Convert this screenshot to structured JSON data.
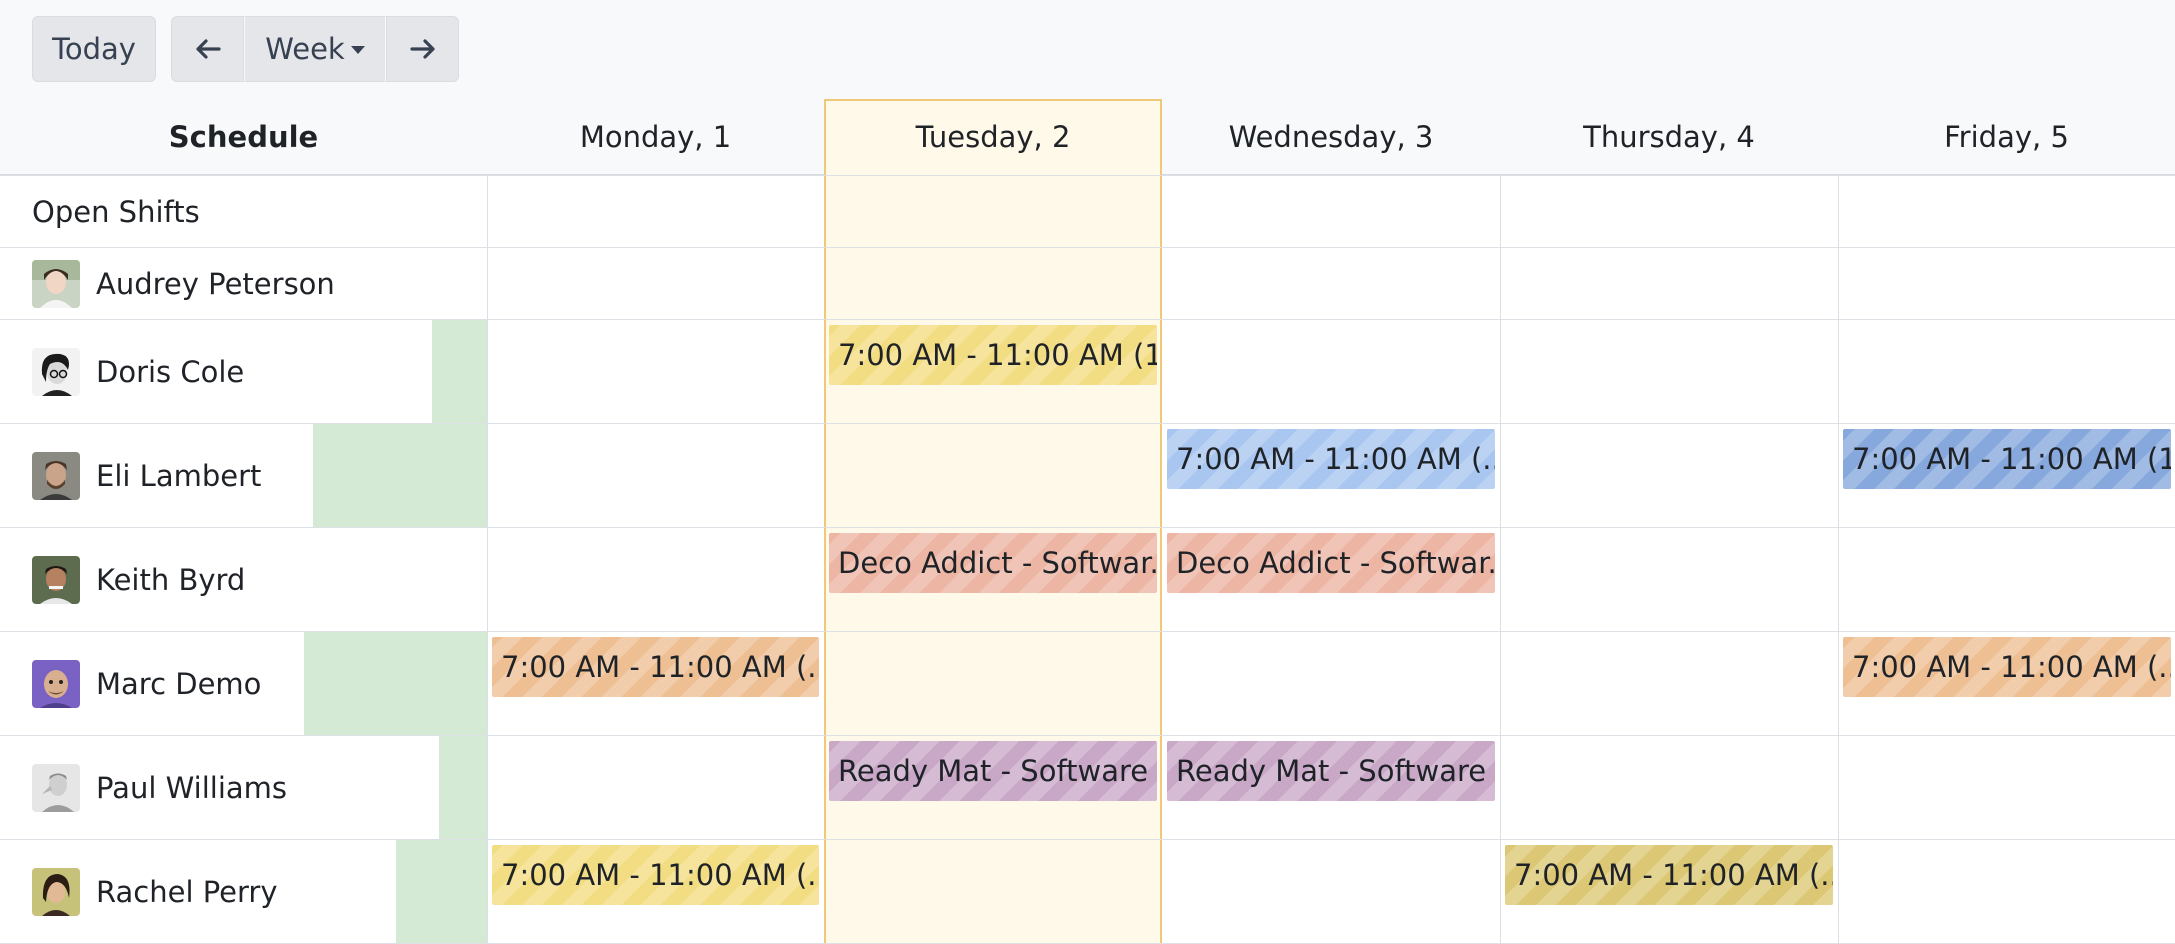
{
  "toolbar": {
    "today_label": "Today",
    "view_label": "Week",
    "prev_icon": "arrow-left-icon",
    "next_icon": "arrow-right-icon"
  },
  "header": {
    "schedule_label": "Schedule",
    "days": [
      "Monday, 1",
      "Tuesday, 2",
      "Wednesday, 3",
      "Thursday, 4",
      "Friday, 5"
    ],
    "today_index": 1
  },
  "rows": [
    {
      "name": "Open Shifts"
    },
    {
      "name": "Audrey Peterson"
    },
    {
      "name": "Doris Cole"
    },
    {
      "name": "Eli Lambert"
    },
    {
      "name": "Keith Byrd"
    },
    {
      "name": "Marc Demo"
    },
    {
      "name": "Paul Williams"
    },
    {
      "name": "Rachel Perry"
    }
  ],
  "shifts": {
    "doris_tue": "7:00 AM - 11:00 AM (1...",
    "eli_wed": "7:00 AM - 11:00 AM (...",
    "eli_fri": "7:00 AM - 11:00 AM (1...",
    "keith_tue": "Deco Addict - Softwar...",
    "keith_wed": "Deco Addict - Softwar...",
    "marc_mon": "7:00 AM - 11:00 AM (...",
    "marc_fri": "7:00 AM - 11:00 AM (...",
    "paul_tue": "Ready Mat - Software ...",
    "paul_wed": "Ready Mat - Software ...",
    "rachel_mon": "7:00 AM - 11:00 AM (...",
    "rachel_thu": "7:00 AM - 11:00 AM (..."
  },
  "colors": {
    "yellow": "#f3dd82",
    "blue": "#a8c6ef",
    "blue_dark": "#86a8dc",
    "salmon": "#ecb5a4",
    "orange": "#efbf94",
    "purple": "#c9a8c7",
    "olive": "#dcc874",
    "today_bg": "#fff9e9",
    "today_border": "#f0c87a",
    "capacity_green": "#d4ead4"
  }
}
